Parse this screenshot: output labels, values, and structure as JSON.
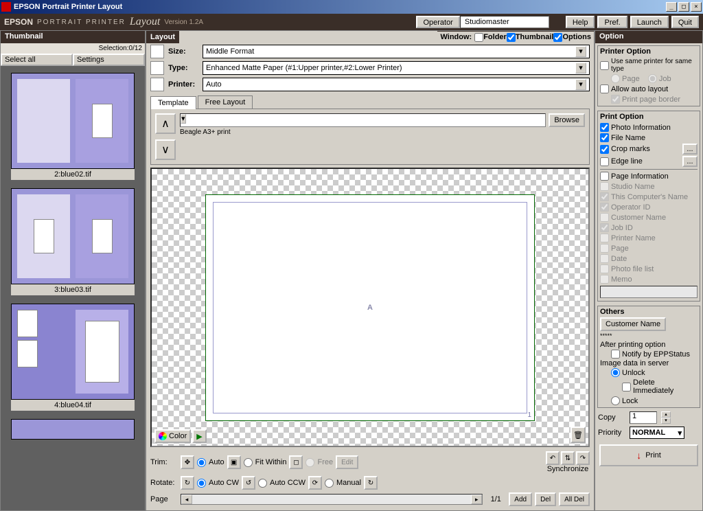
{
  "titlebar": {
    "title": "EPSON Portrait Printer Layout"
  },
  "brandbar": {
    "brand": "EPSON",
    "sub": "PORTRAIT PRINTER",
    "layout": "Layout",
    "version": "Version 1.2A",
    "operator_label": "Operator",
    "operator_value": "Studiomaster",
    "help": "Help",
    "pref": "Pref.",
    "launch": "Launch",
    "quit": "Quit"
  },
  "thumbnail": {
    "header": "Thumbnail",
    "selection": "Selection:0/12",
    "select_all": "Select all",
    "settings": "Settings",
    "items": [
      {
        "caption": "2:blue02.tif"
      },
      {
        "caption": "3:blue03.tif"
      },
      {
        "caption": "4:blue04.tif"
      }
    ]
  },
  "layout": {
    "header": "Layout",
    "window_label": "Window:",
    "win_folder": "Folder",
    "win_thumbnail": "Thumbnail",
    "win_options": "Options",
    "size_label": "Size:",
    "size_value": "Middle Format",
    "type_label": "Type:",
    "type_value": "Enhanced Matte Paper    (#1:Upper printer,#2:Lower Printer)",
    "printer_label": "Printer:",
    "printer_value": "Auto",
    "tab_template": "Template",
    "tab_freelayout": "Free Layout",
    "browse": "Browse",
    "template_caption": "Beagle A3+ print",
    "canvas_letter": "A",
    "canvas_page": "1",
    "color_btn": "Color",
    "trim_label": "Trim:",
    "trim_auto": "Auto",
    "trim_fitwithin": "Fit Within",
    "trim_free": "Free",
    "trim_edit": "Edit",
    "rotate_label": "Rotate:",
    "rotate_autocw": "Auto CW",
    "rotate_autoccw": "Auto CCW",
    "rotate_manual": "Manual",
    "sync": "Synchronize",
    "page_label": "Page",
    "page_count": "1/1",
    "add": "Add",
    "del": "Del",
    "alldel": "All Del"
  },
  "option": {
    "header": "Option",
    "printer_option": "Printer Option",
    "use_same": "Use same printer for same type",
    "page_radio": "Page",
    "job_radio": "Job",
    "allow_auto": "Allow auto layout",
    "print_border": "Print page border",
    "print_option": "Print Option",
    "photo_info": "Photo Information",
    "file_name": "File Name",
    "crop_marks": "Crop marks",
    "edge_line": "Edge line",
    "page_info": "Page Information",
    "studio_name": "Studio Name",
    "computer_name": "This Computer's Name",
    "operator_id": "Operator ID",
    "customer_name_pi": "Customer Name",
    "job_id": "Job ID",
    "printer_name": "Printer Name",
    "page_item": "Page",
    "date_item": "Date",
    "photo_file_list": "Photo file list",
    "memo": "Memo",
    "others": "Others",
    "customer_name_btn": "Customer Name",
    "stars": "*****",
    "after_printing": "After printing option",
    "notify": "Notify by EPPStatus",
    "image_data": "Image data in server",
    "unlock": "Unlock",
    "delete_imm": "Delete Immediately",
    "lock": "Lock",
    "copy_label": "Copy",
    "copy_value": "1",
    "priority_label": "Priority",
    "priority_value": "NORMAL",
    "print": "Print"
  }
}
